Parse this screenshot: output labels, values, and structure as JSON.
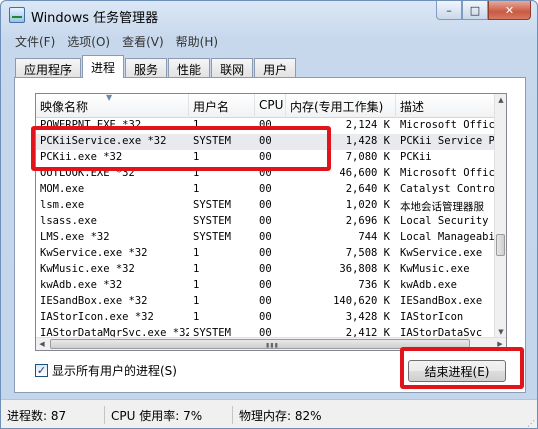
{
  "window": {
    "title": "Windows 任务管理器",
    "minimize": "–",
    "maximize": "□",
    "close": "✕"
  },
  "menu": [
    "文件(F)",
    "选项(O)",
    "查看(V)",
    "帮助(H)"
  ],
  "tabs": [
    "应用程序",
    "进程",
    "服务",
    "性能",
    "联网",
    "用户"
  ],
  "active_tab": "进程",
  "table": {
    "columns": [
      "映像名称",
      "用户名",
      "CPU",
      "内存(专用工作集)",
      "描述"
    ],
    "rows": [
      [
        "POWERPNT.EXE *32",
        "1",
        "00",
        "2,124 K",
        "Microsoft Offic"
      ],
      [
        "PCKiiService.exe *32",
        "SYSTEM",
        "00",
        "1,428 K",
        "PCKii Service P"
      ],
      [
        "PCKii.exe *32",
        "1",
        "00",
        "7,080 K",
        "PCKii"
      ],
      [
        "OUTLOOK.EXE *32",
        "1",
        "00",
        "46,600 K",
        "Microsoft Offic"
      ],
      [
        "MOM.exe",
        "1",
        "00",
        "2,640 K",
        "Catalyst Contro"
      ],
      [
        "lsm.exe",
        "SYSTEM",
        "00",
        "1,020 K",
        "本地会话管理器服"
      ],
      [
        "lsass.exe",
        "SYSTEM",
        "00",
        "2,696 K",
        "Local Security"
      ],
      [
        "LMS.exe *32",
        "SYSTEM",
        "00",
        "744 K",
        "Local Manageabi"
      ],
      [
        "KwService.exe *32",
        "1",
        "00",
        "7,508 K",
        "KwService.exe"
      ],
      [
        "KwMusic.exe *32",
        "1",
        "00",
        "36,808 K",
        "KwMusic.exe"
      ],
      [
        "kwAdb.exe *32",
        "1",
        "00",
        "736 K",
        "kwAdb.exe"
      ],
      [
        "IESandBox.exe *32",
        "1",
        "00",
        "140,620 K",
        "IESandBox.exe"
      ],
      [
        "IAStorIcon.exe *32",
        "1",
        "00",
        "3,428 K",
        "IAStorIcon"
      ],
      [
        "IAStorDataMgrSvc.exe *32",
        "SYSTEM",
        "00",
        "2,412 K",
        "IAStorDataSvc"
      ]
    ],
    "selected_row": 1
  },
  "show_all_users": {
    "checked": "✓",
    "label": "显示所有用户的进程(S)"
  },
  "end_process_label": "结束进程(E)",
  "status": {
    "processes": "进程数: 87",
    "cpu": "CPU 使用率: 7%",
    "memory": "物理内存: 82%"
  },
  "highlight_color": "#e0141a"
}
